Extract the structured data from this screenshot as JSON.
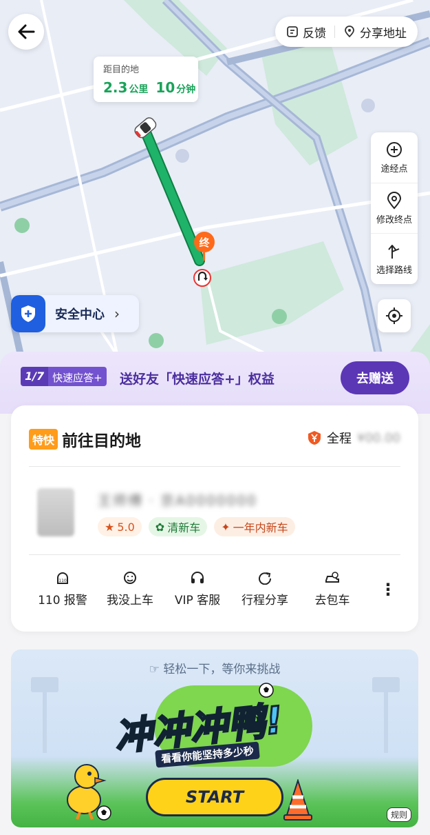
{
  "map": {
    "eta_card": {
      "label": "距目的地",
      "distance_value": "2.3",
      "distance_unit": "公里",
      "time_value": "10",
      "time_unit": "分钟"
    },
    "destination_marker": "终",
    "top_actions": {
      "feedback_label": "反馈",
      "share_label": "分享地址"
    },
    "tools": [
      {
        "icon": "add-waypoint-icon",
        "label": "途经点"
      },
      {
        "icon": "location-pin-icon",
        "label": "修改终点"
      },
      {
        "icon": "route-select-icon",
        "label": "选择路线"
      }
    ],
    "safety_center_label": "安全中心",
    "route_color": "#1aa35a"
  },
  "promo": {
    "tag_number": "1/7",
    "tag_text": "快速应答+",
    "slogan": "送好友「快速应答+」权益",
    "button_label": "去赠送",
    "accent": "#5b37b6"
  },
  "trip": {
    "service_badge": "特快",
    "title": "前往目的地",
    "fare_label": "全程",
    "fare_value": "¥00.00",
    "driver_name_masked": "王师傅 · 京A0000000",
    "rating": "5.0",
    "tags": [
      "清新车",
      "一年内新车"
    ],
    "actions": [
      {
        "icon": "alarm-110-icon",
        "label": "110 报警"
      },
      {
        "icon": "not-boarded-icon",
        "label": "我没上车"
      },
      {
        "icon": "headset-icon",
        "label": "VIP 客服"
      },
      {
        "icon": "share-trip-icon",
        "label": "行程分享"
      },
      {
        "icon": "charter-car-icon",
        "label": "去包车"
      }
    ]
  },
  "game": {
    "hint": "轻松一下，等你来挑战",
    "title": "冲冲冲鸭!",
    "subtitle": "看看你能坚持多少秒",
    "start_label": "START",
    "rules_label": "规则"
  }
}
